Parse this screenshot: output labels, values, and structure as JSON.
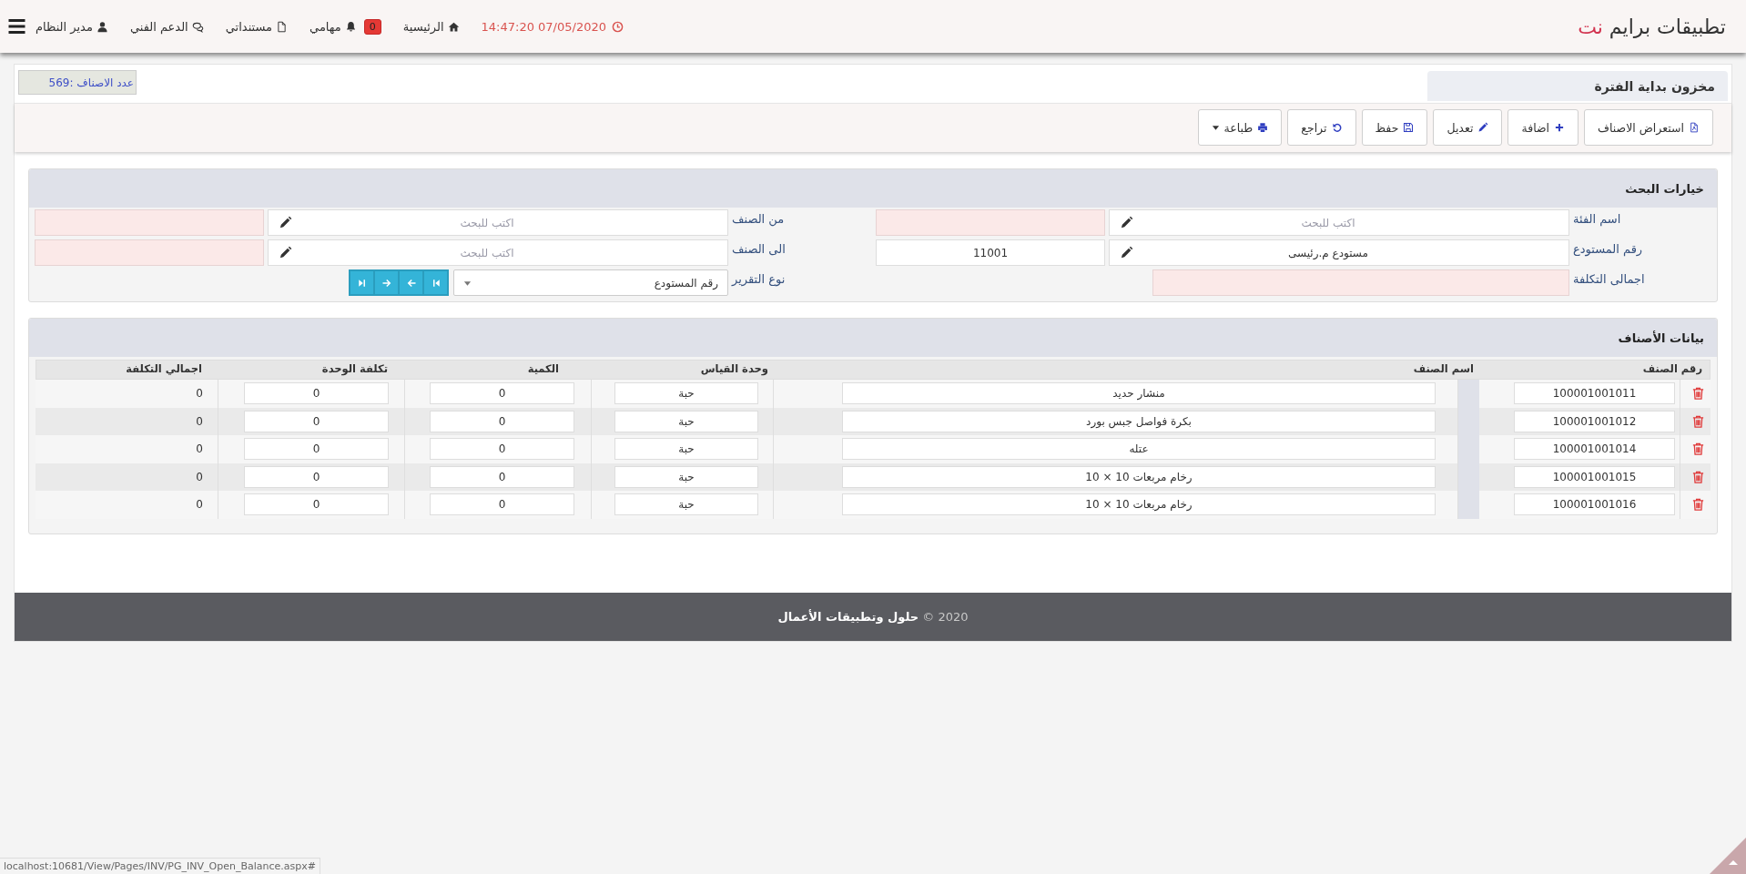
{
  "header": {
    "title": "تطبيقات برايم",
    "title_accent": "نت",
    "datetime": "14:47:20 07/05/2020",
    "nav": [
      {
        "kind": "home",
        "label": "الرئيسية"
      },
      {
        "kind": "tasks",
        "label": "مهامي",
        "badge": "0"
      },
      {
        "kind": "documents",
        "label": "مستنداتي"
      },
      {
        "kind": "support",
        "label": "الدعم الفني"
      },
      {
        "kind": "user",
        "label": "مدير النظام"
      }
    ]
  },
  "page": {
    "title": "مخزون بداية الفترة",
    "item_count": "عدد الاصناف :569"
  },
  "toolbar": [
    {
      "kind": "browse",
      "label": "استعراض الاصناف",
      "dropdown": false
    },
    {
      "kind": "add",
      "label": "اضافة",
      "dropdown": false
    },
    {
      "kind": "edit",
      "label": "تعديل",
      "dropdown": false
    },
    {
      "kind": "save",
      "label": "حفظ",
      "dropdown": false
    },
    {
      "kind": "undo",
      "label": "تراجع",
      "dropdown": false
    },
    {
      "kind": "print",
      "label": "طباعة",
      "dropdown": true
    }
  ],
  "search": {
    "title": "خيارات البحث",
    "fields": [
      {
        "kind": "lookup",
        "label": "اسم الفئة",
        "placeholder": "اكتب للبحث"
      },
      {
        "kind": "lookup",
        "label": "من الصنف",
        "placeholder": "اكتب للبحث"
      },
      {
        "kind": "lookup",
        "label": "رقم المستودع",
        "value": "مستودع م.رئيسى",
        "code": "11001"
      },
      {
        "kind": "lookup",
        "label": "الى الصنف",
        "placeholder": "اكتب للبحث"
      },
      {
        "kind": "readonly",
        "label": "اجمالى التكلفة"
      },
      {
        "kind": "select",
        "label": "نوع التقرير",
        "value": "رقم المستودع",
        "pager": true
      }
    ]
  },
  "items": {
    "title": "بيانات الأصناف",
    "columns": [
      "رقم الصنف",
      "اسم الصنف",
      "وحدة القياس",
      "الكمية",
      "تكلفة الوحدة",
      "اجمالي التكلفة"
    ],
    "rows": [
      {
        "item_no": "100001001011",
        "name": "منشار حديد",
        "unit": "حبة",
        "quantity": "0",
        "unit_cost": "0",
        "total": "0"
      },
      {
        "item_no": "100001001012",
        "name": "بكرة فواصل جبس بورد",
        "unit": "حبة",
        "quantity": "0",
        "unit_cost": "0",
        "total": "0"
      },
      {
        "item_no": "100001001014",
        "name": "عتله",
        "unit": "حبة",
        "quantity": "0",
        "unit_cost": "0",
        "total": "0"
      },
      {
        "item_no": "100001001015",
        "name": "رخام مربعات 10 × 10",
        "unit": "حبة",
        "quantity": "0",
        "unit_cost": "0",
        "total": "0"
      },
      {
        "item_no": "100001001016",
        "name": "رخام مربعات 10 × 10",
        "unit": "حبة",
        "quantity": "0",
        "unit_cost": "0",
        "total": "0"
      }
    ]
  },
  "footer": {
    "text": "2020 © **حلول وتطبيقات الأعمال**"
  },
  "status_url": "localhost:10681/View/Pages/INV/PG_INV_Open_Balance.aspx#"
}
